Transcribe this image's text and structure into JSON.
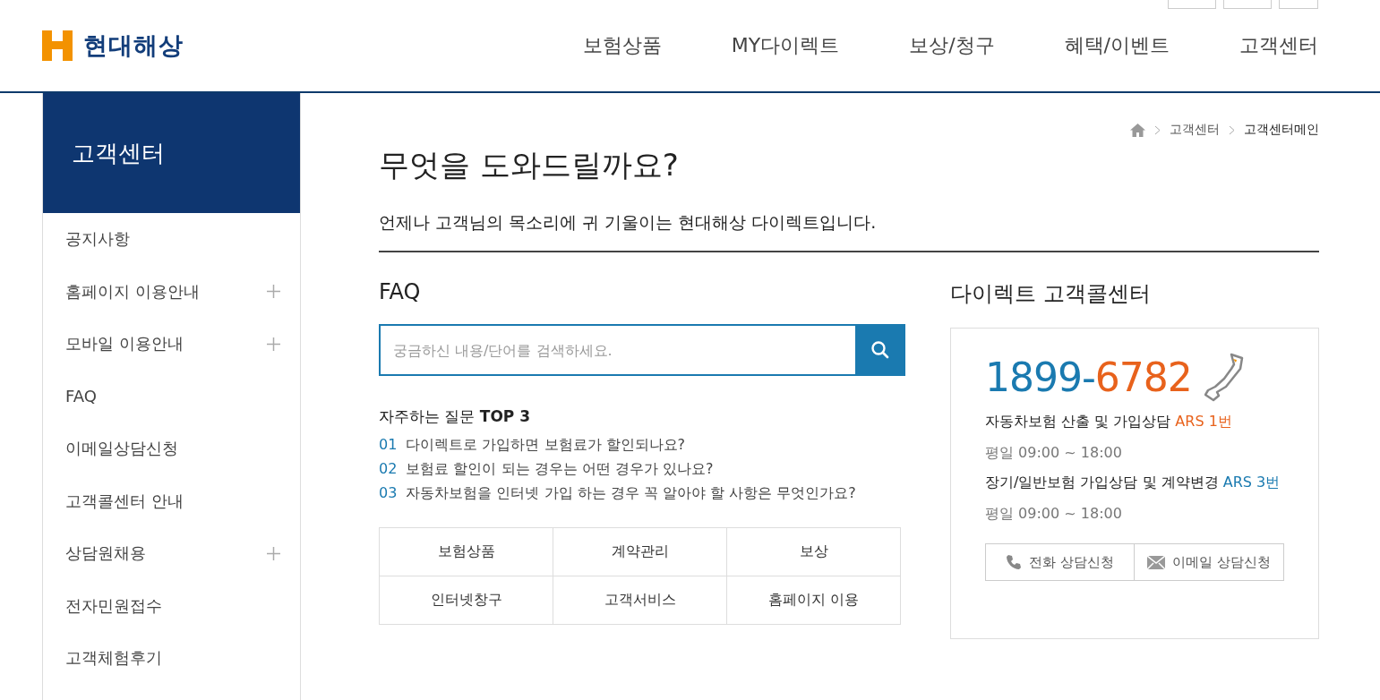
{
  "logo": {
    "text": "현대해상"
  },
  "nav": [
    "보험상품",
    "MY다이렉트",
    "보상/청구",
    "혜택/이벤트",
    "고객센터"
  ],
  "sidebar": {
    "title": "고객센터",
    "items": [
      {
        "label": "공지사항",
        "expandable": false
      },
      {
        "label": "홈페이지 이용안내",
        "expandable": true
      },
      {
        "label": "모바일 이용안내",
        "expandable": true
      },
      {
        "label": "FAQ",
        "expandable": false
      },
      {
        "label": "이메일상담신청",
        "expandable": false
      },
      {
        "label": "고객콜센터 안내",
        "expandable": false
      },
      {
        "label": "상담원채용",
        "expandable": true
      },
      {
        "label": "전자민원접수",
        "expandable": false
      },
      {
        "label": "고객체험후기",
        "expandable": false
      }
    ]
  },
  "breadcrumb": [
    "고객센터",
    "고객센터메인"
  ],
  "heading": "무엇을 도와드릴까요?",
  "subheading": "언제나 고객님의 목소리에 귀 기울이는 현대해상 다이렉트입니다.",
  "faq": {
    "title": "FAQ",
    "search": {
      "placeholder": "궁금하신 내용/단어를 검색하세요."
    },
    "top_title": "자주하는 질문 **TOP 3**",
    "questions": [
      {
        "num": "01",
        "text": "다이렉트로 가입하면 보험료가 할인되나요?"
      },
      {
        "num": "02",
        "text": "보험료 할인이 되는 경우는 어떤 경우가 있나요?"
      },
      {
        "num": "03",
        "text": "자동차보험을 인터넷 가입 하는 경우 꼭 알아야 할 사항은 무엇인가요?"
      }
    ],
    "categories": [
      "보험상품",
      "계약관리",
      "보상",
      "인터넷창구",
      "고객서비스",
      "홈페이지 이용"
    ]
  },
  "callcenter": {
    "title": "다이렉트 고객콜센터",
    "phone_prefix": "1899-",
    "phone_suffix": "6782",
    "lines": [
      {
        "desc": "자동차보험 산출 및 가입상담 ",
        "ars": "ARS 1번",
        "color": "#e8621c",
        "hours": "평일 09:00 ~ 18:00"
      },
      {
        "desc": "장기/일반보험 가입상담 및 계약변경 ",
        "ars": "ARS 3번",
        "color": "#1a7ab0",
        "hours": "평일 09:00 ~ 18:00"
      }
    ],
    "buttons": [
      {
        "kind": "phone",
        "label": "전화 상담신청"
      },
      {
        "kind": "email",
        "label": "이메일 상담신청"
      }
    ]
  }
}
